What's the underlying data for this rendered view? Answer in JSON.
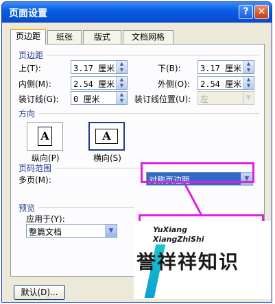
{
  "window": {
    "title": "页面设置",
    "help_glyph": "?",
    "close_glyph": "✕"
  },
  "tabs": [
    {
      "label": "页边距",
      "active": true
    },
    {
      "label": "纸张",
      "active": false
    },
    {
      "label": "版式",
      "active": false
    },
    {
      "label": "文档网格",
      "active": false
    }
  ],
  "margins": {
    "section_title": "页边距",
    "top": {
      "label": "上(T):",
      "value": "3.17 厘米"
    },
    "bottom": {
      "label": "下(B):",
      "value": "3.17 厘米"
    },
    "inside": {
      "label": "内侧(M):",
      "value": "2.54 厘米"
    },
    "outside": {
      "label": "外侧(O):",
      "value": "2.54 厘米"
    },
    "gutter": {
      "label": "装订线(G):",
      "value": "0 厘米"
    },
    "gutter_position": {
      "label": "装订线位置(U):",
      "value": "左",
      "disabled": true
    }
  },
  "orientation": {
    "section_title": "方向",
    "portrait": {
      "label": "纵向(P)",
      "glyph": "A",
      "selected": false
    },
    "landscape": {
      "label": "横向(S)",
      "glyph": "A",
      "selected": true
    }
  },
  "pages": {
    "section_title": "页码范围",
    "multiple_label": "多页(M):",
    "multiple_value": "对称页边距"
  },
  "preview": {
    "section_title": "预览",
    "apply_label": "应用于(Y):",
    "apply_value": "整篇文档"
  },
  "buttons": {
    "default": "默认(D)..."
  },
  "watermark": {
    "line1": "YuXiang",
    "line2": "XiangZhiShi",
    "brand": "誉祥祥知识"
  },
  "colors": {
    "highlight": "#e020e0",
    "title_bar": "#0a5ee4",
    "selection": "#316ac5"
  }
}
